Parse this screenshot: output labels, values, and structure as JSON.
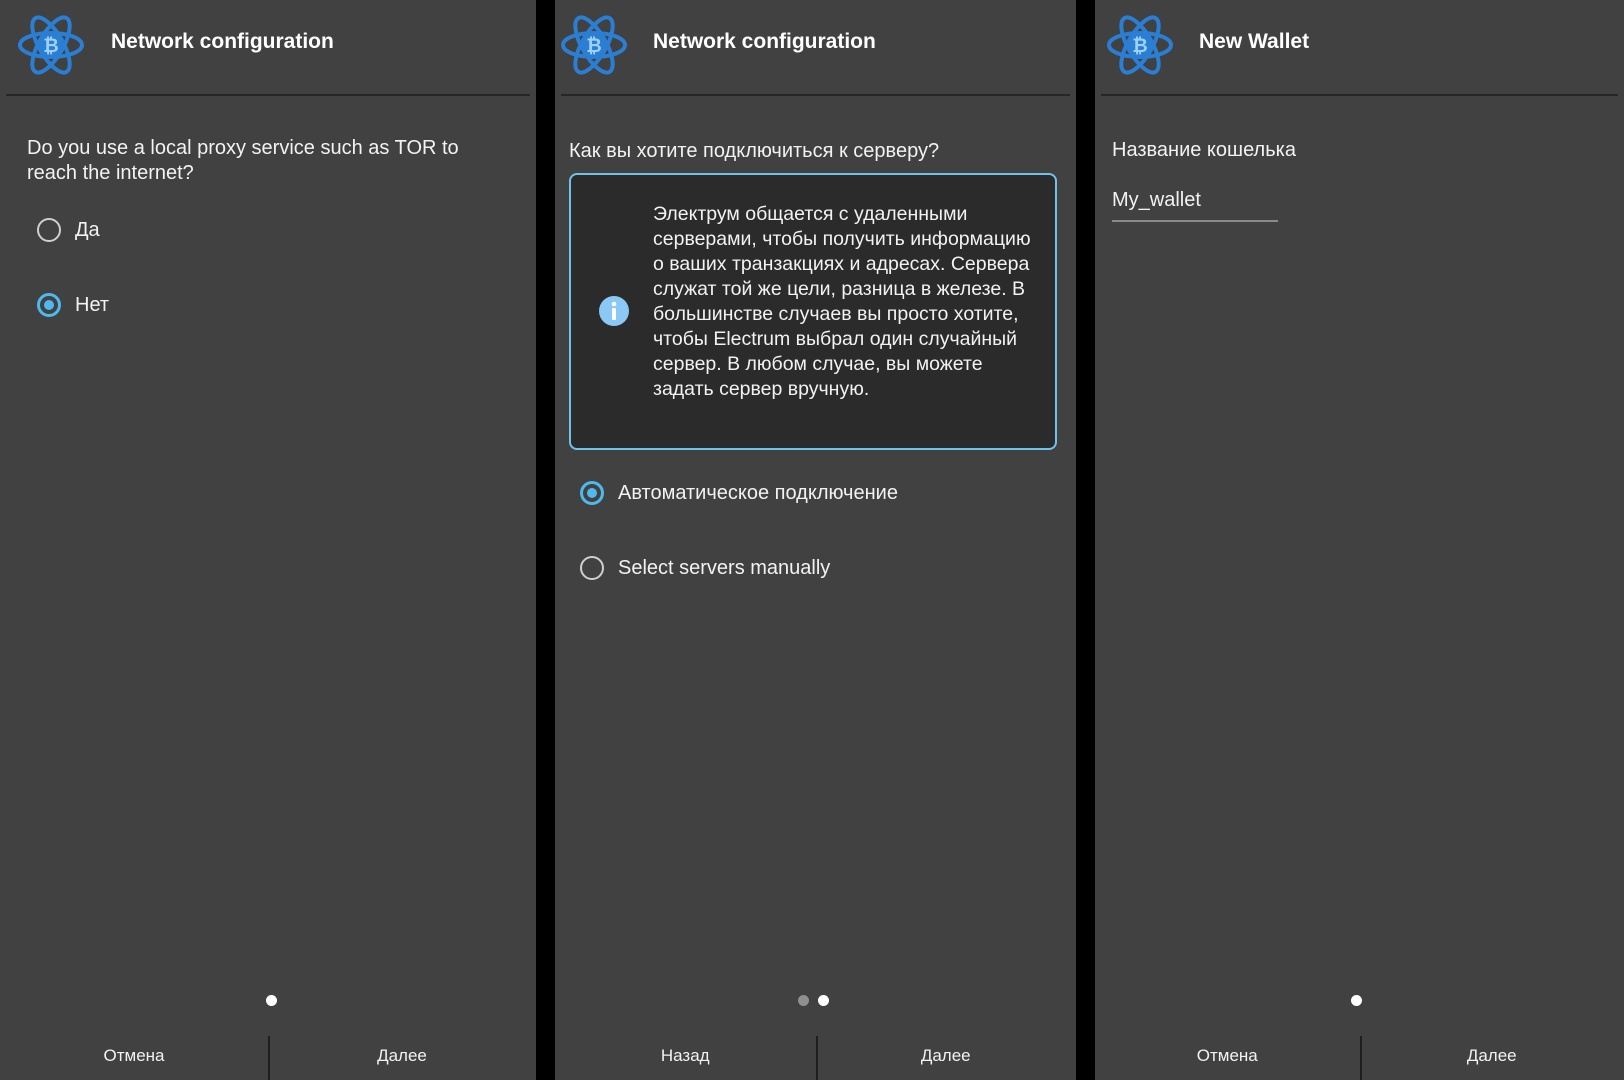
{
  "colors": {
    "panel_bg": "#414141",
    "accent": "#4fb9ef",
    "logo_blue": "#2a7fd4",
    "info_border": "#6fc3ea",
    "info_icon": "#8cc8f5"
  },
  "panel1": {
    "header": {
      "title": "Network configuration",
      "icon": "electrum-logo-icon"
    },
    "question": "Do you use a local proxy service such as TOR to reach the internet?",
    "options": [
      {
        "label": "Да",
        "checked": false
      },
      {
        "label": "Нет",
        "checked": true
      }
    ],
    "page_indicator": {
      "total": 1,
      "active": 1
    },
    "footer": {
      "cancel_label": "Отмена",
      "next_label": "Далее"
    }
  },
  "panel2": {
    "header": {
      "title": "Network configuration",
      "icon": "electrum-logo-icon"
    },
    "question": "Как вы хотите подключиться к серверу?",
    "info": {
      "icon": "info-icon",
      "text": "Электрум общается с удаленными серверами, чтобы получить информацию о ваших транзакциях и адресах.  Сервера служат той же цели, разница в железе. В большинстве случаев вы просто хотите, чтобы Electrum выбрал один случайный сервер. В любом случае, вы можете задать сервер вручную."
    },
    "options": [
      {
        "label": "Автоматическое подключение",
        "checked": true
      },
      {
        "label": "Select servers manually",
        "checked": false
      }
    ],
    "page_indicator": {
      "total": 2,
      "active": 2
    },
    "footer": {
      "back_label": "Назад",
      "next_label": "Далее"
    }
  },
  "panel3": {
    "header": {
      "title": "New Wallet",
      "icon": "electrum-logo-icon"
    },
    "wallet_name_label": "Название кошелька",
    "wallet_name_value": "My_wallet",
    "page_indicator": {
      "total": 1,
      "active": 1
    },
    "footer": {
      "cancel_label": "Отмена",
      "next_label": "Далее"
    }
  }
}
